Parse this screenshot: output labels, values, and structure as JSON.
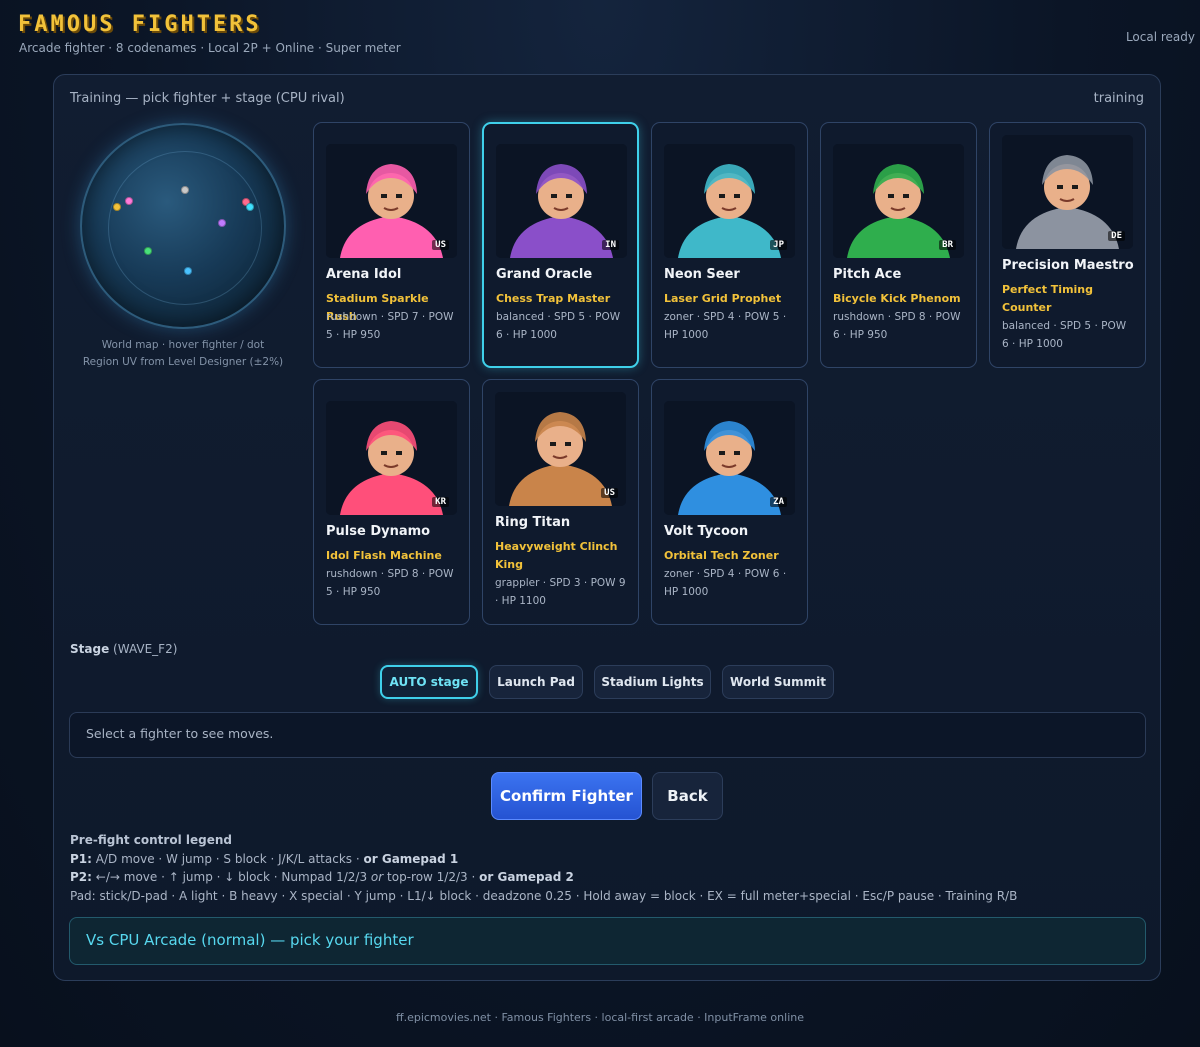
{
  "header": {
    "title": "FAMOUS FIGHTERS",
    "subtitle": "Arcade fighter · 8 codenames · Local 2P + Online · Super meter",
    "status": "Local ready"
  },
  "panel": {
    "heading": "Training — pick fighter + stage (CPU rival)",
    "mode": "training"
  },
  "map": {
    "caption_line1": "World map · hover fighter / dot",
    "caption_line2": "Region UV from Level Designer (±2%)",
    "dot_colors": [
      "#f2c23a",
      "#ff7ad9",
      "#c9c9c9",
      "#ff6b8e",
      "#3fe0ff",
      "#c07bff",
      "#49e07a",
      "#4ac2ff"
    ]
  },
  "fighters": [
    {
      "name": "Arena Idol",
      "epithet": "Stadium Sparkle Rush",
      "style": "rushdown",
      "spd": "7",
      "pow": "5",
      "hp": "950",
      "country": "US",
      "color": "#ff5fb0",
      "stats_text": "rushdown · SPD 7 · POW 5 · HP 950"
    },
    {
      "name": "Grand Oracle",
      "epithet": "Chess Trap Master",
      "style": "balanced",
      "spd": "5",
      "pow": "6",
      "hp": "1000",
      "country": "IN",
      "color": "#8a4fc9",
      "stats_text": "balanced · SPD 5 · POW 6 · HP 1000"
    },
    {
      "name": "Neon Seer",
      "epithet": "Laser Grid Prophet",
      "style": "zoner",
      "spd": "4",
      "pow": "5",
      "hp": "1000",
      "country": "JP",
      "color": "#3fb8c9",
      "stats_text": "zoner · SPD 4 · POW 5 · HP 1000"
    },
    {
      "name": "Pitch Ace",
      "epithet": "Bicycle Kick Phenom",
      "style": "rushdown",
      "spd": "8",
      "pow": "6",
      "hp": "950",
      "country": "BR",
      "color": "#2fae4d",
      "stats_text": "rushdown · SPD 8 · POW 6 · HP 950"
    },
    {
      "name": "Precision Maestro",
      "epithet": "Perfect Timing Counter",
      "style": "balanced",
      "spd": "5",
      "pow": "6",
      "hp": "1000",
      "country": "DE",
      "color": "#8c93a0",
      "stats_text": "balanced · SPD 5 · POW 6 · HP 1000"
    },
    {
      "name": "Pulse Dynamo",
      "epithet": "Idol Flash Machine",
      "style": "rushdown",
      "spd": "8",
      "pow": "5",
      "hp": "950",
      "country": "KR",
      "color": "#ff4f7a",
      "stats_text": "rushdown · SPD 8 · POW 5 · HP 950"
    },
    {
      "name": "Ring Titan",
      "epithet": "Heavyweight Clinch King",
      "style": "grappler",
      "spd": "3",
      "pow": "9",
      "hp": "1100",
      "country": "US",
      "color": "#c9844a",
      "stats_text": "grappler · SPD 3 · POW 9 · HP 1100"
    },
    {
      "name": "Volt Tycoon",
      "epithet": "Orbital Tech Zoner",
      "style": "zoner",
      "spd": "4",
      "pow": "6",
      "hp": "1000",
      "country": "ZA",
      "color": "#2f8fe0",
      "stats_text": "zoner · SPD 4 · POW 6 · HP 1000"
    }
  ],
  "stage": {
    "label": "Stage",
    "code": "(WAVE_F2)",
    "options": [
      "AUTO stage",
      "Launch Pad",
      "Stadium Lights",
      "World Summit"
    ]
  },
  "moves_hint": "Select a fighter to see moves.",
  "actions": {
    "confirm": "Confirm Fighter",
    "back": "Back"
  },
  "legend": {
    "title": "Pre-fight control legend",
    "p1_label": "P1:",
    "p1_text": "A/D move · W jump · S block · J/K/L attacks ·",
    "p1_or": "or Gamepad 1",
    "p2_label": "P2:",
    "p2_text": "←/→ move · ↑ jump · ↓ block · Numpad 1/2/3",
    "p2_or_word": "or",
    "p2_text2": "top-row 1/2/3 ·",
    "p2_or": "or Gamepad 2",
    "pad": "Pad: stick/D-pad · A light · B heavy · X special · Y jump · L1/↓ block · deadzone 0.25 · Hold away = block · EX = full meter+special · Esc/P pause · Training R/B"
  },
  "banner": "Vs CPU Arcade (normal) — pick your fighter",
  "footer": "ff.epicmovies.net · Famous Fighters · local-first arcade · InputFrame online"
}
